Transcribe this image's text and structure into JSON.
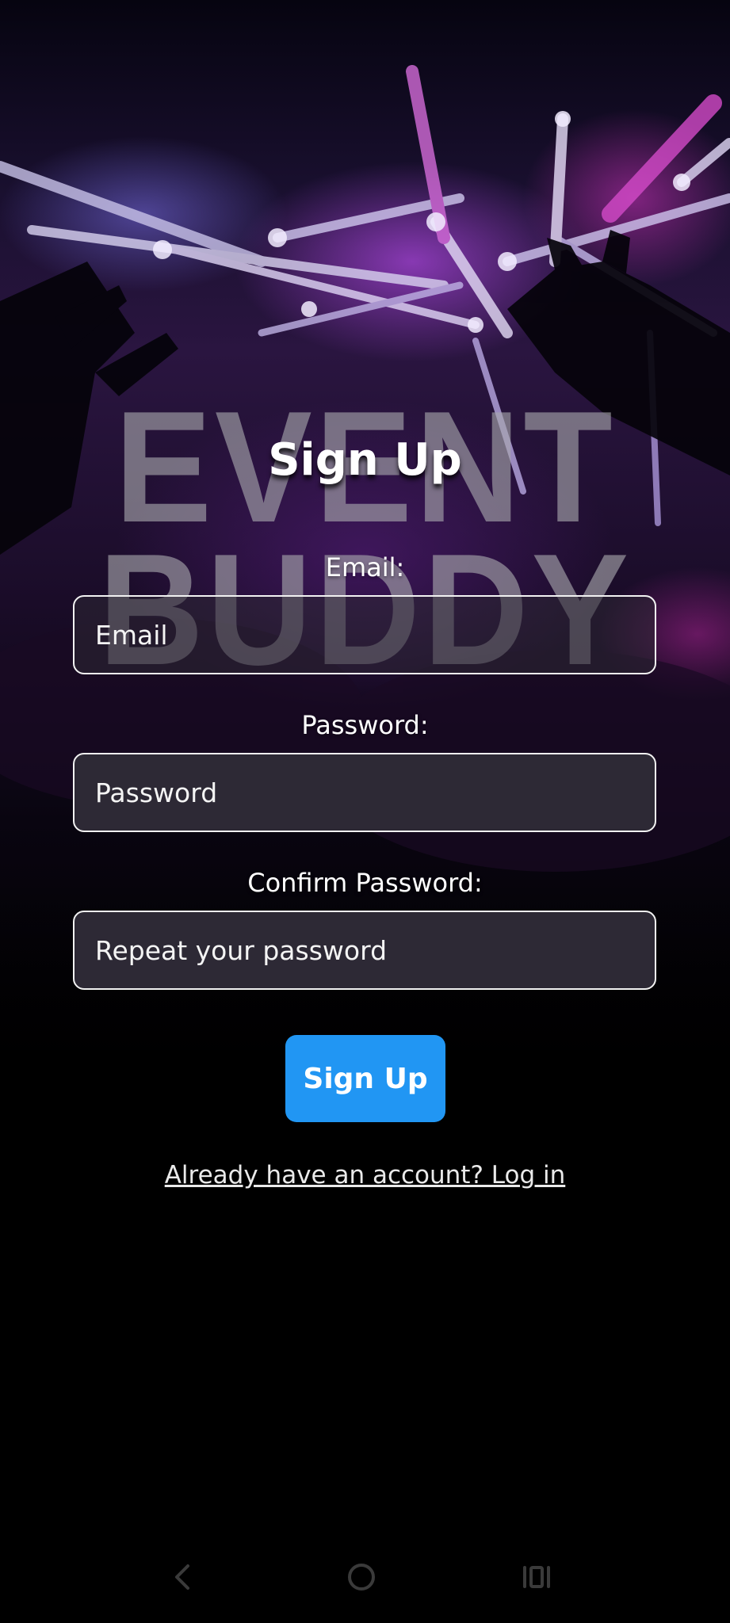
{
  "app": {
    "logo_text_line1": "EVENT",
    "logo_text_line2": "BUDDY"
  },
  "form": {
    "title": "Sign Up",
    "email_label": "Email:",
    "email_placeholder": "Email",
    "password_label": "Password:",
    "password_placeholder": "Password",
    "confirm_label": "Confirm Password:",
    "confirm_placeholder": "Repeat your password",
    "submit_label": "Sign Up",
    "login_link": "Already have an account? Log in"
  },
  "navbar": {
    "items": [
      {
        "icon": "back-icon"
      },
      {
        "icon": "home-icon"
      },
      {
        "icon": "recent-apps-icon"
      }
    ]
  },
  "colors": {
    "accent": "#2196f3",
    "background": "#000000",
    "input_fill": "#2d2935"
  }
}
